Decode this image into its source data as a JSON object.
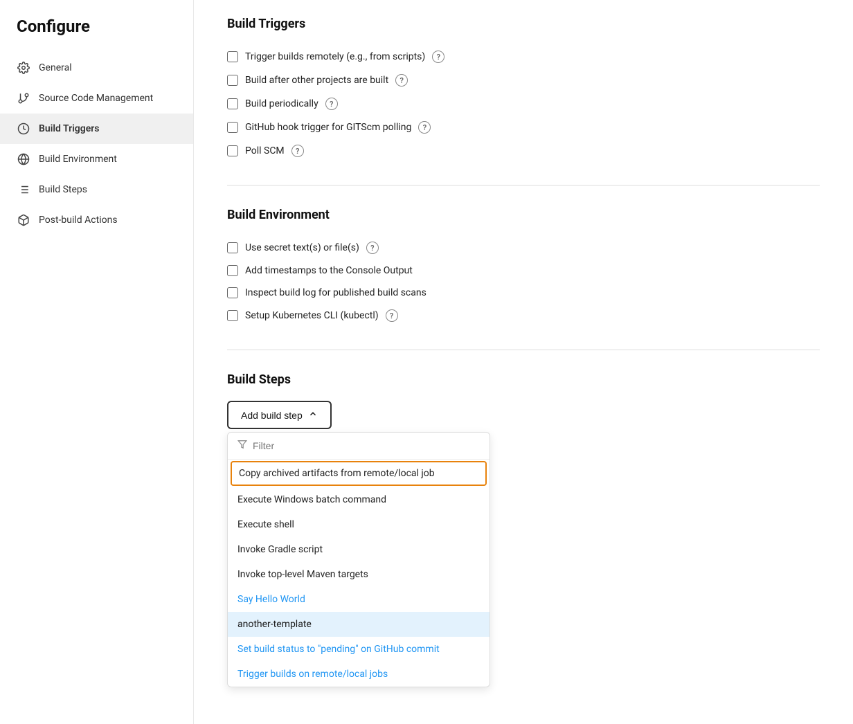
{
  "page": {
    "title": "Configure"
  },
  "sidebar": {
    "items": [
      {
        "id": "general",
        "label": "General",
        "icon": "gear"
      },
      {
        "id": "source-code",
        "label": "Source Code Management",
        "icon": "branch"
      },
      {
        "id": "build-triggers",
        "label": "Build Triggers",
        "icon": "clock",
        "active": true
      },
      {
        "id": "build-environment",
        "label": "Build Environment",
        "icon": "globe"
      },
      {
        "id": "build-steps",
        "label": "Build Steps",
        "icon": "list"
      },
      {
        "id": "post-build",
        "label": "Post-build Actions",
        "icon": "box"
      }
    ]
  },
  "sections": {
    "build_triggers": {
      "title": "Build Triggers",
      "items": [
        {
          "id": "trigger-remote",
          "label": "Trigger builds remotely (e.g., from scripts)",
          "has_help": true
        },
        {
          "id": "build-after",
          "label": "Build after other projects are built",
          "has_help": true
        },
        {
          "id": "build-periodically",
          "label": "Build periodically",
          "has_help": true
        },
        {
          "id": "github-hook",
          "label": "GitHub hook trigger for GITScm polling",
          "has_help": true
        },
        {
          "id": "poll-scm",
          "label": "Poll SCM",
          "has_help": true
        }
      ]
    },
    "build_environment": {
      "title": "Build Environment",
      "items": [
        {
          "id": "secret-text",
          "label": "Use secret text(s) or file(s)",
          "has_help": true
        },
        {
          "id": "add-timestamps",
          "label": "Add timestamps to the Console Output",
          "has_help": false
        },
        {
          "id": "inspect-log",
          "label": "Inspect build log for published build scans",
          "has_help": false
        },
        {
          "id": "setup-kubectl",
          "label": "Setup Kubernetes CLI (kubectl)",
          "has_help": true
        }
      ]
    },
    "build_steps": {
      "title": "Build Steps",
      "add_button_label": "Add build step",
      "filter_placeholder": "Filter",
      "dropdown_items": [
        {
          "id": "copy-archived",
          "label": "Copy archived artifacts from remote/local job",
          "highlighted": true
        },
        {
          "id": "execute-windows",
          "label": "Execute Windows batch command",
          "style": "normal"
        },
        {
          "id": "execute-shell",
          "label": "Execute shell",
          "style": "normal"
        },
        {
          "id": "invoke-gradle",
          "label": "Invoke Gradle script",
          "style": "normal"
        },
        {
          "id": "invoke-maven",
          "label": "Invoke top-level Maven targets",
          "style": "normal"
        },
        {
          "id": "say-hello",
          "label": "Say Hello World",
          "style": "blue"
        },
        {
          "id": "another-template",
          "label": "another-template",
          "style": "highlight-blue"
        },
        {
          "id": "set-build-status",
          "label": "Set build status to \"pending\" on GitHub commit",
          "style": "blue"
        },
        {
          "id": "trigger-builds",
          "label": "Trigger builds on remote/local jobs",
          "style": "blue"
        }
      ]
    }
  },
  "icons": {
    "gear": "⚙",
    "branch": "⎇",
    "clock": "◔",
    "globe": "⊕",
    "list": "≡",
    "box": "◫",
    "help": "?",
    "filter": "⊽",
    "chevron_up": "∧"
  }
}
